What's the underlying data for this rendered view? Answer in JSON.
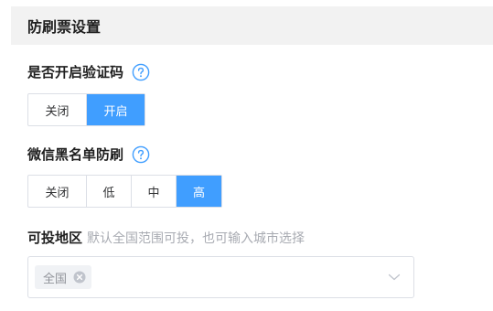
{
  "section": {
    "title": "防刷票设置"
  },
  "captcha": {
    "label": "是否开启验证码",
    "options": [
      "关闭",
      "开启"
    ],
    "selected": "开启"
  },
  "wechat_blacklist": {
    "label": "微信黑名单防刷",
    "options": [
      "关闭",
      "低",
      "中",
      "高"
    ],
    "selected": "高"
  },
  "region": {
    "label": "可投地区",
    "hint": "默认全国范围可投，也可输入城市选择",
    "selected_tags": [
      "全国"
    ]
  },
  "colors": {
    "accent": "#409eff",
    "border": "#dcdfe6",
    "header_bg": "#f2f2f2"
  },
  "icons": {
    "help": "question-circle-icon",
    "tag_close": "close-circle-icon",
    "dropdown": "chevron-down-icon"
  }
}
